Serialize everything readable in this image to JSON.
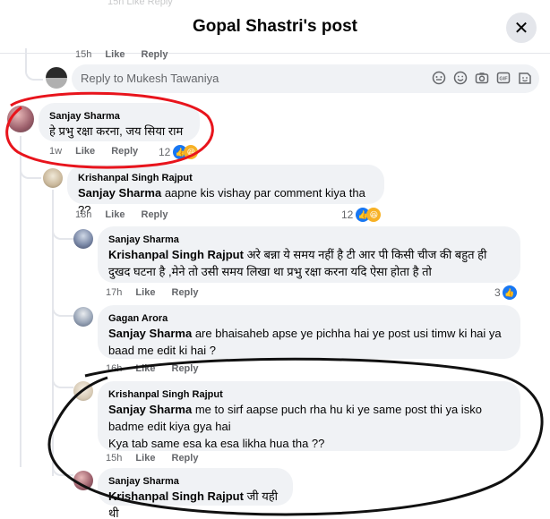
{
  "header": {
    "title": "Gopal Shastri's post",
    "close_glyph": "✕",
    "faded_top": "15h  Like  Reply"
  },
  "top_meta": {
    "time": "15h",
    "like": "Like",
    "reply": "Reply"
  },
  "reply_box": {
    "placeholder": "Reply to Mukesh Tawaniya",
    "icons": [
      "sticker-icon",
      "emoji-icon",
      "camera-icon",
      "gif-icon",
      "sticker-face-icon"
    ]
  },
  "comments": [
    {
      "author": "Sanjay Sharma",
      "text": "हे प्रभु रक्षा करना, जय सिया राम",
      "time": "1w",
      "like": "Like",
      "reply": "Reply",
      "reaction_count": "12"
    },
    {
      "author": "Krishanpal Singh Rajput",
      "mention": "Sanjay Sharma",
      "text": " aapne kis vishay par comment kiya tha ??",
      "time": "18h",
      "like": "Like",
      "reply": "Reply",
      "reaction_count": "12"
    },
    {
      "author": "Sanjay Sharma",
      "mention": "Krishanpal Singh Rajput",
      "text_line1": " अरे बन्ना ये समय नहीं है टी आर पी किसी चीज की बहुत ही",
      "text_line2": "दुखद घटना है ,मेने तो उसी समय लिखा था प्रभु रक्षा करना यदि ऐसा होता है तो",
      "time": "17h",
      "like": "Like",
      "reply": "Reply",
      "reaction_count": "3"
    },
    {
      "author": "Gagan Arora",
      "mention": "Sanjay Sharma",
      "text_line1": " are bhaisaheb apse ye pichha hai ye post usi timw ki hai ya",
      "text_line2": "baad me edit ki hai ?",
      "time": "16h",
      "like": "Like",
      "reply": "Reply"
    },
    {
      "author": "Krishanpal Singh Rajput",
      "mention": "Sanjay Sharma",
      "text_line1": " me to sirf aapse puch rha hu ki ye same post thi ya isko",
      "text_line2": "badme edit kiya gya hai",
      "text_line3": "Kya tab same esa ka esa likha hua tha ??",
      "time": "15h",
      "like": "Like",
      "reply": "Reply"
    },
    {
      "author": "Sanjay Sharma",
      "mention": "Krishanpal Singh Rajput",
      "text": " जी यही थी"
    }
  ],
  "colors": {
    "annotation_red": "#e8141c",
    "annotation_black": "#111111",
    "like_blue": "#1877f2",
    "haha_yellow": "#f7b125",
    "bubble_gray": "#f0f2f5"
  }
}
